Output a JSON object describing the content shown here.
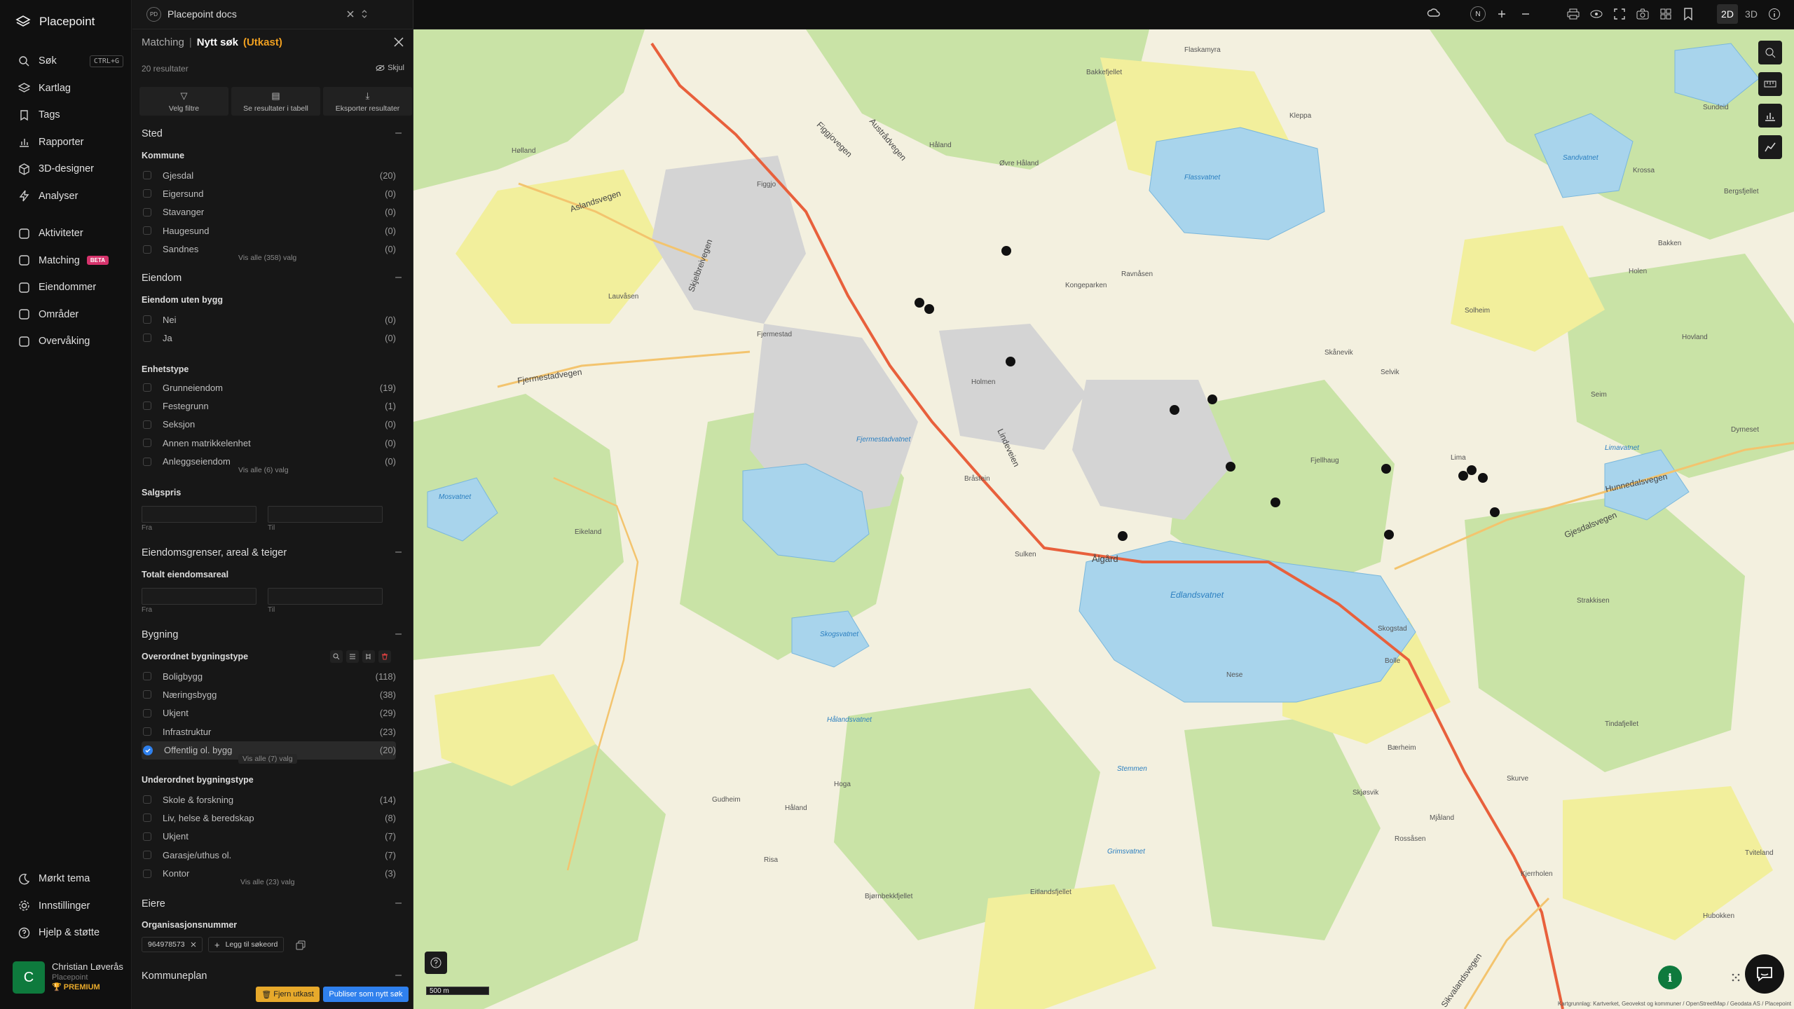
{
  "app": {
    "name": "Placepoint",
    "workspace_badge": "PD",
    "workspace": "Placepoint docs"
  },
  "nav": {
    "main": [
      {
        "label": "Søk",
        "icon": "search-icon",
        "shortcut": "CTRL+G"
      },
      {
        "label": "Kartlag",
        "icon": "layers-icon"
      },
      {
        "label": "Tags",
        "icon": "bookmark-icon"
      },
      {
        "label": "Rapporter",
        "icon": "report-chart-icon"
      },
      {
        "label": "3D-designer",
        "icon": "cube-icon"
      },
      {
        "label": "Analyser",
        "icon": "lightning-icon"
      }
    ],
    "secondary": [
      {
        "label": "Aktiviteter",
        "icon": "activity-icon"
      },
      {
        "label": "Matching",
        "icon": "matching-icon",
        "badge": "BETA"
      },
      {
        "label": "Eiendommer",
        "icon": "property-icon"
      },
      {
        "label": "Områder",
        "icon": "area-icon"
      },
      {
        "label": "Overvåking",
        "icon": "monitor-icon"
      }
    ],
    "bottom": [
      {
        "label": "Mørkt tema",
        "icon": "moon-icon"
      },
      {
        "label": "Innstillinger",
        "icon": "gear-icon"
      },
      {
        "label": "Hjelp & støtte",
        "icon": "help-icon"
      }
    ]
  },
  "user": {
    "initial": "C",
    "name": "Christian Løverås",
    "org": "Placepoint",
    "plan": "PREMIUM"
  },
  "panel": {
    "breadcrumb": "Matching",
    "separator": "|",
    "title": "Nytt søk",
    "status": "(Utkast)",
    "results": "20 resultater",
    "hide_label": "Skjul",
    "actions": [
      {
        "label": "Velg filtre",
        "icon": "filter-icon"
      },
      {
        "label": "Se resultater i tabell",
        "icon": "table-icon"
      },
      {
        "label": "Eksporter resultater",
        "icon": "download-icon"
      }
    ],
    "collapse": "–",
    "sted": {
      "title": "Sted",
      "kommune_label": "Kommune",
      "kommune": [
        {
          "name": "Gjesdal",
          "count": "(20)"
        },
        {
          "name": "Eigersund",
          "count": "(0)"
        },
        {
          "name": "Stavanger",
          "count": "(0)"
        },
        {
          "name": "Haugesund",
          "count": "(0)"
        },
        {
          "name": "Sandnes",
          "count": "(0)"
        }
      ],
      "more": "Vis alle (358) valg"
    },
    "eiendom": {
      "title": "Eiendom",
      "uten_label": "Eiendom uten bygg",
      "uten": [
        {
          "name": "Nei",
          "count": "(0)"
        },
        {
          "name": "Ja",
          "count": "(0)"
        }
      ],
      "enhet_label": "Enhetstype",
      "enhet": [
        {
          "name": "Grunneiendom",
          "count": "(19)"
        },
        {
          "name": "Festegrunn",
          "count": "(1)"
        },
        {
          "name": "Seksjon",
          "count": "(0)"
        },
        {
          "name": "Annen matrikkelenhet",
          "count": "(0)"
        },
        {
          "name": "Anleggseiendom",
          "count": "(0)"
        }
      ],
      "enhet_more": "Vis alle (6) valg",
      "salgspris_label": "Salgspris",
      "from": "Fra",
      "to": "Til"
    },
    "grenser": {
      "title": "Eiendomsgrenser, areal & teiger",
      "areal_label": "Totalt eiendomsareal",
      "from": "Fra",
      "to": "Til"
    },
    "bygning": {
      "title": "Bygning",
      "over_label": "Overordnet bygningstype",
      "over": [
        {
          "name": "Boligbygg",
          "count": "(118)"
        },
        {
          "name": "Næringsbygg",
          "count": "(38)"
        },
        {
          "name": "Ukjent",
          "count": "(29)"
        },
        {
          "name": "Infrastruktur",
          "count": "(23)"
        },
        {
          "name": "Offentlig ol. bygg",
          "count": "(20)",
          "checked": true
        }
      ],
      "over_more": "Vis alle (7) valg",
      "under_label": "Underordnet bygningstype",
      "under": [
        {
          "name": "Skole & forskning",
          "count": "(14)"
        },
        {
          "name": "Liv, helse & beredskap",
          "count": "(8)"
        },
        {
          "name": "Ukjent",
          "count": "(7)"
        },
        {
          "name": "Garasje/uthus ol.",
          "count": "(7)"
        },
        {
          "name": "Kontor",
          "count": "(3)"
        }
      ],
      "under_more": "Vis alle (23) valg"
    },
    "eiere": {
      "title": "Eiere",
      "org_label": "Organisasjonsnummer",
      "org_value": "964978573",
      "add_label": "Legg til søkeord"
    },
    "kommuneplan": {
      "title": "Kommuneplan"
    },
    "remove_draft": "Fjern utkast",
    "publish": "Publiser som nytt søk"
  },
  "topbar": {
    "mode_2d": "2D",
    "mode_3d": "3D",
    "compass": "N"
  },
  "map": {
    "scale": "500 m",
    "attribution": "Kartgrunnlag: Kartverket, Geovekst og kommuner / OpenStreetMap / Geodata AS / Placepoint",
    "roads": [
      "Aslandsvegen",
      "Skjelbreivegen",
      "Figgjovegen",
      "Austrådvegen",
      "Fjermestadvegen",
      "Hunnedalsvegen",
      "Gjesdalsvegen",
      "Sikvalandsvegen",
      "Lindeveien"
    ],
    "places": [
      "Kongeparken",
      "Ålgård",
      "Hølland",
      "Håland",
      "Øvre Håland",
      "Figgjo",
      "Bakkefjellet",
      "Flaskamyra",
      "Lauvåsen",
      "Fjermestad",
      "Holmen",
      "Bråstein",
      "Sulken",
      "Nese",
      "Tindafjellet",
      "Holen",
      "Bakken",
      "Lima",
      "Hovland",
      "Eikeland",
      "Håland",
      "Hoga",
      "Skurve",
      "Gudheim",
      "Eitlandsfjellet",
      "Bjørnbekkfjellet",
      "Kleppa",
      "Ravnåsen",
      "Solheim",
      "Risa",
      "Bærheim",
      "Rossåsen",
      "Krossa",
      "Sundeid",
      "Dyrneset",
      "Selvik",
      "Seim",
      "Fjellhaug",
      "Hubokken",
      "Tviteland",
      "Bolle",
      "Skogstad",
      "Skånevik",
      "Bergsfjellet",
      "Strakkisen",
      "Kjerrholen",
      "Mjåland",
      "Skjøsvik"
    ],
    "water": [
      "Edlandsvatnet",
      "Limavatnet",
      "Fjermestadvatnet",
      "Mosvatnet",
      "Skogsvatnet",
      "Grimsvatnet",
      "Stemmen",
      "Hålandsvatnet",
      "Flassvatnet",
      "Sandvatnet"
    ]
  }
}
